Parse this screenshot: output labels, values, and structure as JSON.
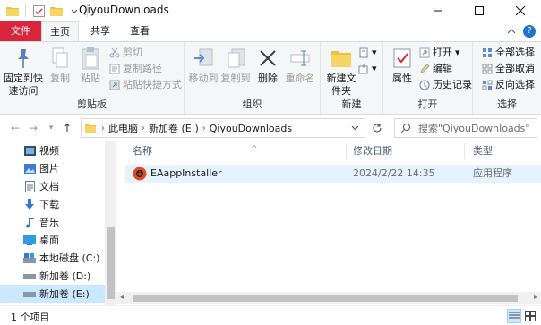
{
  "window": {
    "title": "QiyouDownloads"
  },
  "tabs": {
    "file": "文件",
    "home": "主页",
    "share": "共享",
    "view": "查看"
  },
  "ribbon": {
    "clipboard": {
      "pin": "固定到快速访问",
      "copy": "复制",
      "paste": "粘贴",
      "cut": "剪切",
      "copy_path": "复制路径",
      "paste_shortcut": "粘贴快捷方式",
      "label": "剪贴板"
    },
    "organize": {
      "move_to": "移动到",
      "copy_to": "复制到",
      "delete": "删除",
      "rename": "重命名",
      "label": "组织"
    },
    "new": {
      "new_folder": "新建文件夹",
      "label": "新建"
    },
    "open": {
      "properties": "属性",
      "open": "打开",
      "edit": "编辑",
      "history": "历史记录",
      "label": "打开"
    },
    "select": {
      "select_all": "全部选择",
      "select_none": "全部取消",
      "invert": "反向选择",
      "label": "选择"
    }
  },
  "address": {
    "crumbs": [
      "此电脑",
      "新加卷 (E:)",
      "QiyouDownloads"
    ],
    "search_placeholder": "搜索\"QiyouDownloads\""
  },
  "nav": {
    "items": [
      {
        "label": "视频",
        "icon": "video-icon"
      },
      {
        "label": "图片",
        "icon": "picture-icon"
      },
      {
        "label": "文档",
        "icon": "document-icon"
      },
      {
        "label": "下载",
        "icon": "download-icon"
      },
      {
        "label": "音乐",
        "icon": "music-icon"
      },
      {
        "label": "桌面",
        "icon": "desktop-icon"
      },
      {
        "label": "本地磁盘 (C:)",
        "icon": "drive-c-icon"
      },
      {
        "label": "新加卷 (D:)",
        "icon": "drive-icon"
      },
      {
        "label": "新加卷 (E:)",
        "icon": "drive-icon"
      }
    ]
  },
  "columns": {
    "name": "名称",
    "modified": "修改日期",
    "type": "类型"
  },
  "files": [
    {
      "name": "EAappInstaller",
      "modified": "2024/2/22 14:35",
      "type": "应用程序"
    }
  ],
  "status": {
    "count": "1 个项目"
  },
  "colors": {
    "accent": "#d9263c",
    "selection": "#cce8ff",
    "row_hover": "#e5f3ff",
    "column_header": "#4c607a"
  }
}
